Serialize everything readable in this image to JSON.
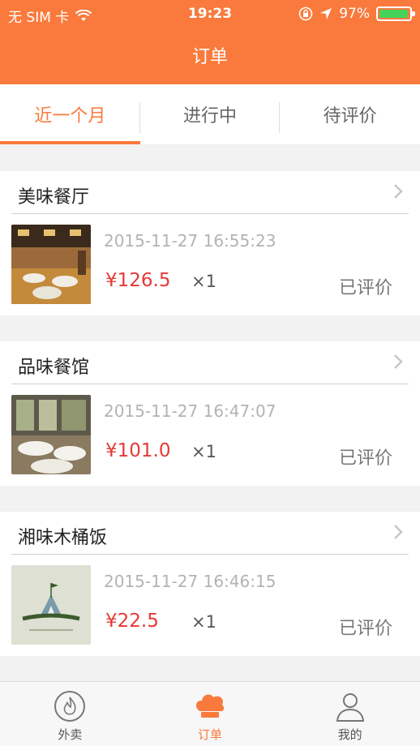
{
  "status_bar": {
    "carrier": "无 SIM 卡",
    "time": "19:23",
    "battery": "97%",
    "battery_level": 0.97
  },
  "header": {
    "title": "订单"
  },
  "tabs": [
    {
      "label": "近一个月",
      "active": true
    },
    {
      "label": "进行中",
      "active": false
    },
    {
      "label": "待评价",
      "active": false
    }
  ],
  "orders": [
    {
      "name": "美味餐厅",
      "date": "2015-11-27 16:55:23",
      "price": "¥126.5",
      "qty": "×1",
      "status": "已评价"
    },
    {
      "name": "品味餐馆",
      "date": "2015-11-27 16:47:07",
      "price": "¥101.0",
      "qty": "×1",
      "status": "已评价"
    },
    {
      "name": "湘味木桶饭",
      "date": "2015-11-27 16:46:15",
      "price": "¥22.5",
      "qty": "×1",
      "status": "已评价"
    }
  ],
  "nav": [
    {
      "label": "外卖",
      "icon": "fire-icon",
      "active": false
    },
    {
      "label": "订单",
      "icon": "chef-hat-icon",
      "active": true
    },
    {
      "label": "我的",
      "icon": "user-icon",
      "active": false
    }
  ],
  "colors": {
    "accent": "#f97a3c",
    "price": "#e53935"
  }
}
